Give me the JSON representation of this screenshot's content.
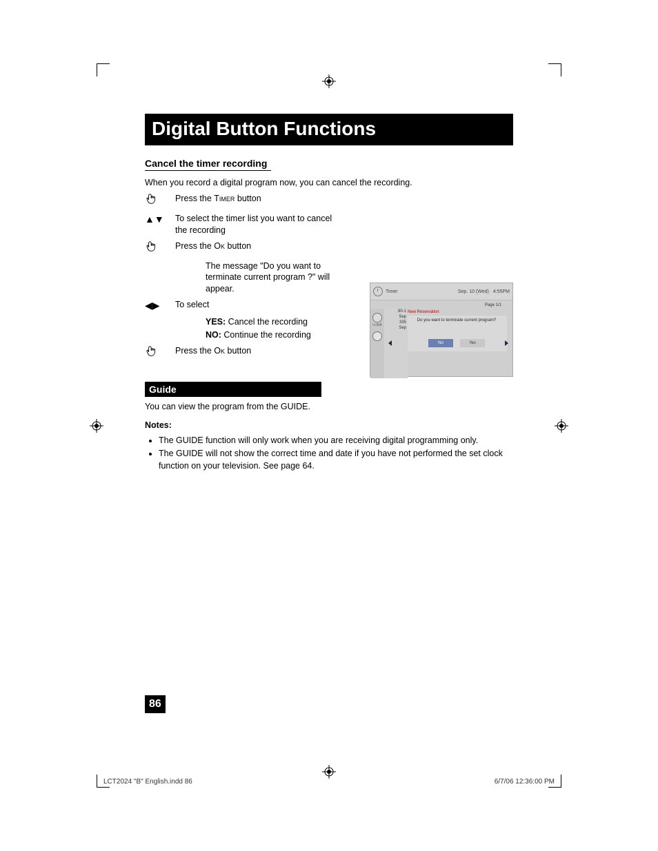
{
  "title": "Digital Button Functions",
  "section1": {
    "heading": "Cancel the timer recording",
    "intro": "When you record a digital program now, you can cancel the recording.",
    "steps": {
      "s1": {
        "prefix": "Press the ",
        "btn": "Timer",
        "suffix": " button"
      },
      "s2": "To select the timer list you want to cancel the recording",
      "s3": {
        "prefix": "Press the ",
        "btn": "Ok",
        "suffix": " button"
      },
      "s3note": "The message \"Do you want to terminate current program ?\" will appear.",
      "s4": "To select",
      "s4yes_label": "YES:",
      "s4yes": "  Cancel the recording",
      "s4no_label": "NO:",
      "s4no": "  Continue the recording",
      "s5": {
        "prefix": "Press the ",
        "btn": "Ok",
        "suffix": " button"
      }
    }
  },
  "section2": {
    "tag": "Guide",
    "intro": "You can view the program from the GUIDE.",
    "notes_label": "Notes:",
    "notes": [
      "The GUIDE function will only work when you are receiving digital programming only.",
      "The GUIDE will not show the correct time and date if you have not performed the set clock function on your television.  See page 64."
    ]
  },
  "osd": {
    "title": "Timer",
    "date": "Sep. 10 (Wed)",
    "time": "4:55PM",
    "page": "Page 1/1",
    "new_reservation": "New Reservation",
    "sidebar": [
      {
        "num": "80-1",
        "sub": "Sep"
      },
      {
        "label": "i-LINK",
        "num": "335",
        "sub": "Sep"
      }
    ],
    "dialog": "Do you want to terminate current program?",
    "no": "No",
    "yes": "Yes"
  },
  "page_number": "86",
  "footer": {
    "left": "LCT2024 \"B\" English.indd   86",
    "right": "6/7/06   12:36:00 PM"
  }
}
